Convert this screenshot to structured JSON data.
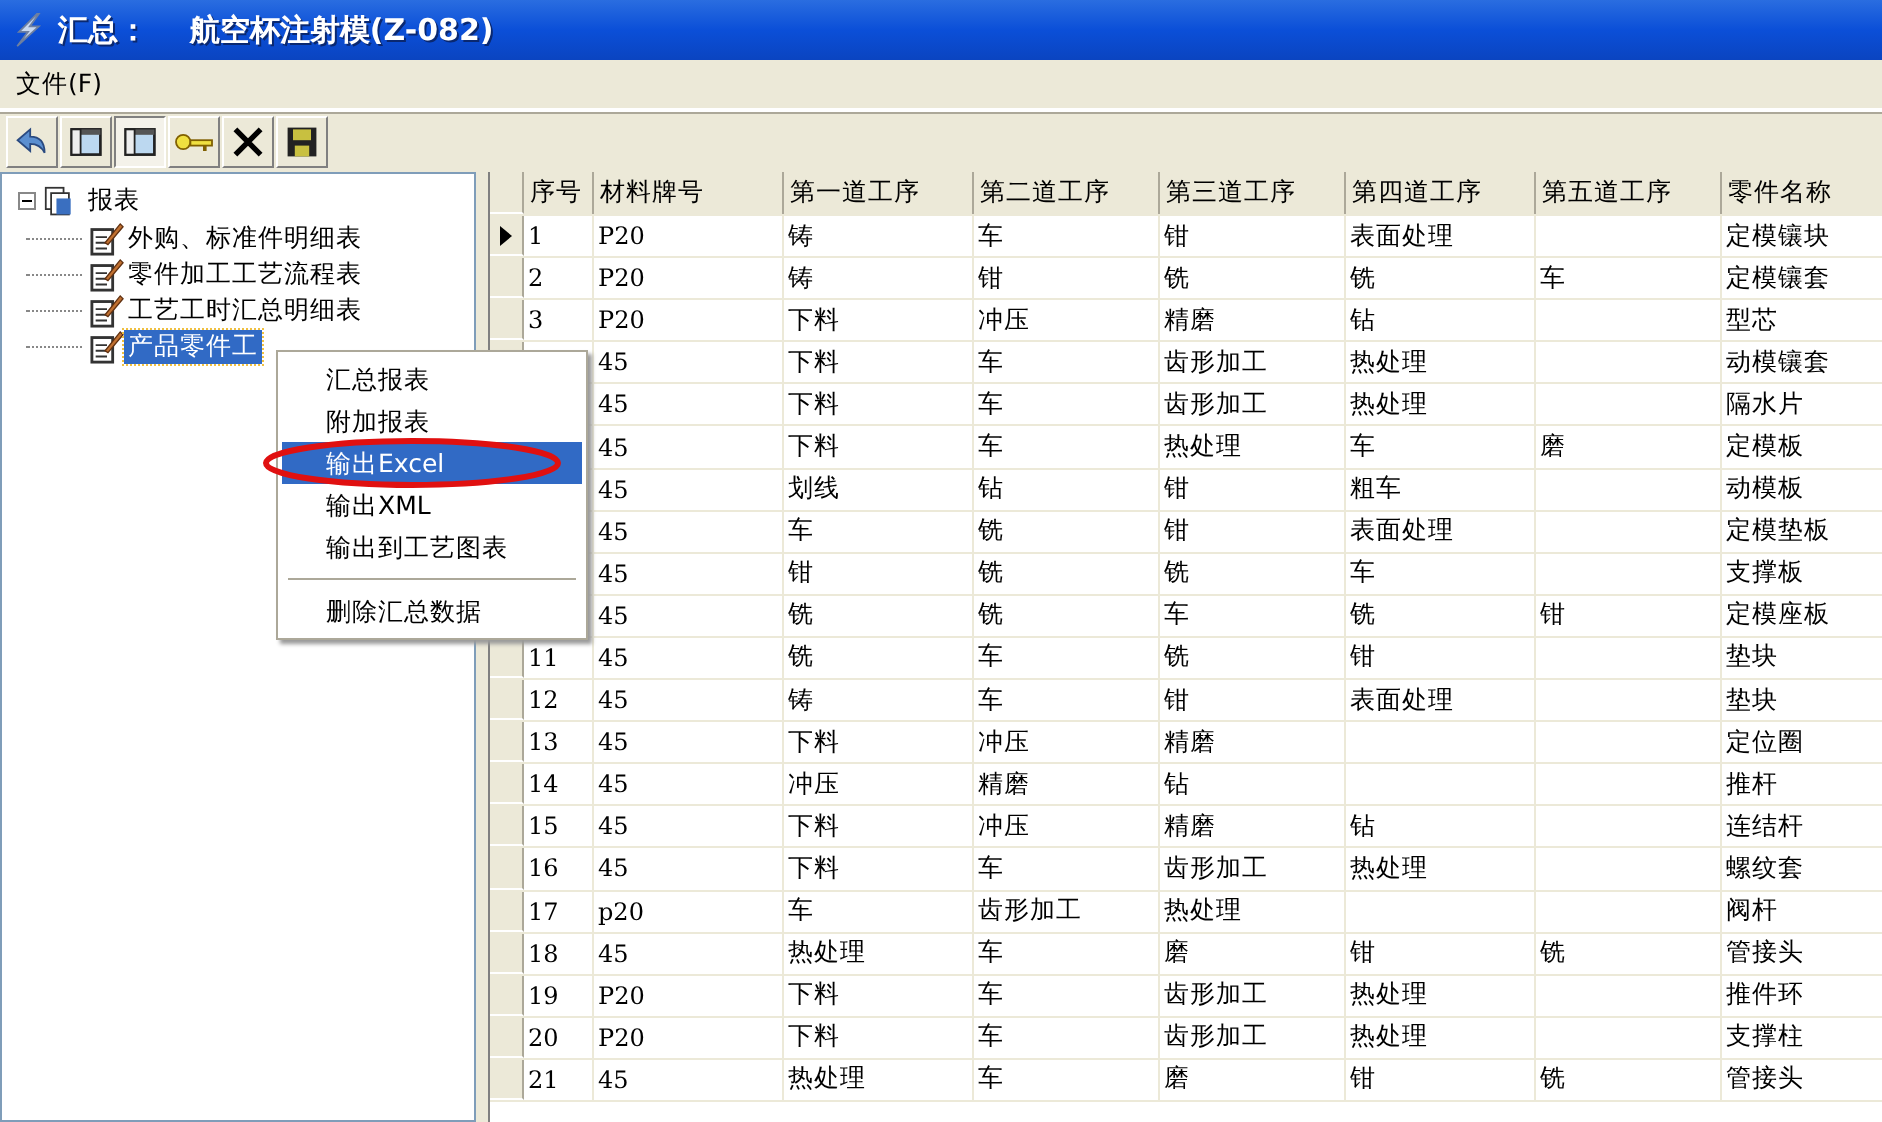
{
  "window": {
    "title": "汇总：    航空杯注射模(Z-082)"
  },
  "menu_bar": [
    {
      "label": "文件(F)"
    }
  ],
  "toolbar": [
    {
      "pressed": false
    },
    {
      "pressed": false
    },
    {
      "pressed": true
    },
    {
      "pressed": false
    },
    {
      "pressed": false
    },
    {
      "pressed": false
    }
  ],
  "tree": {
    "label": "报表",
    "expanded": true,
    "children": [
      {
        "label": "外购、标准件明细表",
        "selected": false
      },
      {
        "label": "零件加工工艺流程表",
        "selected": false
      },
      {
        "label": "工艺工时汇总明细表",
        "selected": false
      },
      {
        "label": "产品零件工",
        "selected": true
      }
    ]
  },
  "context_menu": {
    "items": [
      {
        "kind": "item",
        "label": "汇总报表",
        "highlighted": false
      },
      {
        "kind": "item",
        "label": "附加报表",
        "highlighted": false
      },
      {
        "kind": "item",
        "label": "输出Excel",
        "highlighted": true,
        "circled": true
      },
      {
        "kind": "item",
        "label": "输出XML",
        "highlighted": false
      },
      {
        "kind": "item",
        "label": "输出到工艺图表",
        "highlighted": false
      },
      {
        "kind": "separator"
      },
      {
        "kind": "item",
        "label": "删除汇总数据",
        "highlighted": false
      }
    ]
  },
  "table": {
    "columns": [
      "序号",
      "材料牌号",
      "第一道工序",
      "第二道工序",
      "第三道工序",
      "第四道工序",
      "第五道工序",
      "零件名称"
    ],
    "rows": [
      {
        "current": true,
        "cells": {
          "no": "1",
          "material": "P20",
          "op1": "铸",
          "op2": "车",
          "op3": "钳",
          "op4": "表面处理",
          "name": "定模镶块"
        }
      },
      {
        "current": false,
        "cells": {
          "no": "2",
          "material": "P20",
          "op1": "铸",
          "op2": "钳",
          "op3": "铣",
          "op4": "铣",
          "op5": "车",
          "name": "定模镶套"
        }
      },
      {
        "current": false,
        "cells": {
          "no": "3",
          "material": "P20",
          "op1": "下料",
          "op2": "冲压",
          "op3": "精磨",
          "op4": "钻",
          "name": "型芯"
        }
      },
      {
        "cells": {
          "material": "45",
          "op1": "下料",
          "op2": "车",
          "op3": "齿形加工",
          "op4": "热处理",
          "name": "动模镶套"
        }
      },
      {
        "cells": {
          "material": "45",
          "op1": "下料",
          "op2": "车",
          "op3": "齿形加工",
          "op4": "热处理",
          "name": "隔水片"
        }
      },
      {
        "cells": {
          "material": "45",
          "op1": "下料",
          "op2": "车",
          "op3": "热处理",
          "op4": "车",
          "op5": "磨",
          "name": "定模板"
        }
      },
      {
        "cells": {
          "material": "45",
          "op1": "划线",
          "op2": "钻",
          "op3": "钳",
          "op4": "粗车",
          "name": "动模板"
        }
      },
      {
        "cells": {
          "material": "45",
          "op1": "车",
          "op2": "铣",
          "op3": "钳",
          "op4": "表面处理",
          "name": "定模垫板"
        }
      },
      {
        "cells": {
          "material": "45",
          "op1": "钳",
          "op2": "铣",
          "op3": "铣",
          "op4": "车",
          "name": "支撑板"
        }
      },
      {
        "cells": {
          "material": "45",
          "op1": "铣",
          "op2": "铣",
          "op3": "车",
          "op4": "铣",
          "op5": "钳",
          "name": "定模座板"
        }
      },
      {
        "current": false,
        "cells": {
          "no": "11",
          "material": "45",
          "op1": "铣",
          "op2": "车",
          "op3": "铣",
          "op4": "钳",
          "name": "垫块"
        }
      },
      {
        "current": false,
        "cells": {
          "no": "12",
          "material": "45",
          "op1": "铸",
          "op2": "车",
          "op3": "钳",
          "op4": "表面处理",
          "name": "垫块"
        }
      },
      {
        "current": false,
        "cells": {
          "no": "13",
          "material": "45",
          "op1": "下料",
          "op2": "冲压",
          "op3": "精磨",
          "name": "定位圈"
        }
      },
      {
        "current": false,
        "cells": {
          "no": "14",
          "material": "45",
          "op1": "冲压",
          "op2": "精磨",
          "op3": "钻",
          "name": "推杆"
        }
      },
      {
        "current": false,
        "cells": {
          "no": "15",
          "material": "45",
          "op1": "下料",
          "op2": "冲压",
          "op3": "精磨",
          "op4": "钻",
          "name": "连结杆"
        }
      },
      {
        "current": false,
        "cells": {
          "no": "16",
          "material": "45",
          "op1": "下料",
          "op2": "车",
          "op3": "齿形加工",
          "op4": "热处理",
          "name": "螺纹套"
        }
      },
      {
        "current": false,
        "cells": {
          "no": "17",
          "material": "p20",
          "op1": "车",
          "op2": "齿形加工",
          "op3": "热处理",
          "name": "阀杆"
        }
      },
      {
        "current": false,
        "cells": {
          "no": "18",
          "material": "45",
          "op1": "热处理",
          "op2": "车",
          "op3": "磨",
          "op4": "钳",
          "op5": "铣",
          "name": "管接头"
        }
      },
      {
        "current": false,
        "cells": {
          "no": "19",
          "material": "P20",
          "op1": "下料",
          "op2": "车",
          "op3": "齿形加工",
          "op4": "热处理",
          "name": "推件环"
        }
      },
      {
        "current": false,
        "cells": {
          "no": "20",
          "material": "P20",
          "op1": "下料",
          "op2": "车",
          "op3": "齿形加工",
          "op4": "热处理",
          "name": "支撑柱"
        }
      },
      {
        "current": false,
        "cells": {
          "no": "21",
          "material": "45",
          "op1": "热处理",
          "op2": "车",
          "op3": "磨",
          "op4": "钳",
          "op5": "铣",
          "name": "管接头"
        }
      }
    ]
  }
}
